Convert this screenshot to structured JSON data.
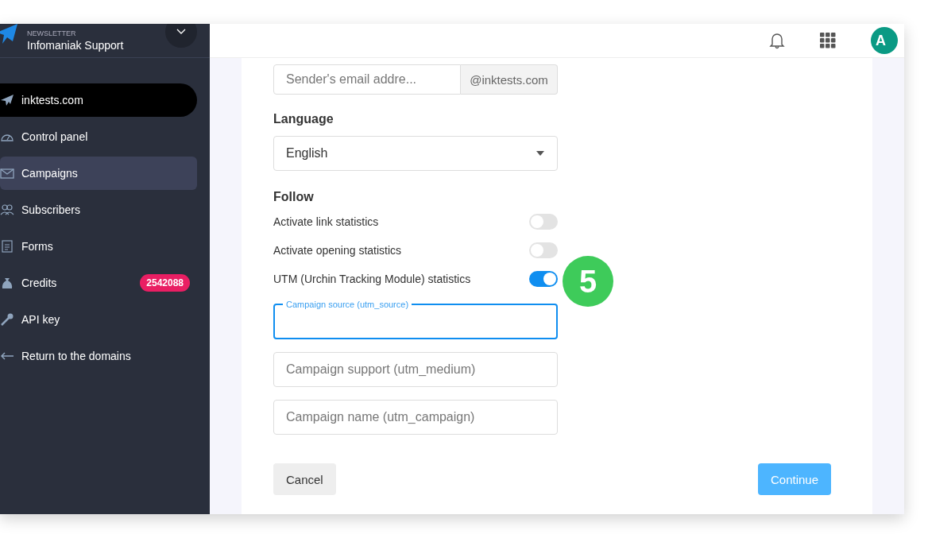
{
  "sidebar": {
    "product": "NEWSLETTER",
    "account": "Infomaniak Support",
    "items": [
      {
        "label": "inktests.com",
        "kind": "domain",
        "selected": false
      },
      {
        "label": "Control panel",
        "kind": "nav",
        "selected": false
      },
      {
        "label": "Campaigns",
        "kind": "nav",
        "selected": true
      },
      {
        "label": "Subscribers",
        "kind": "nav",
        "selected": false
      },
      {
        "label": "Forms",
        "kind": "nav",
        "selected": false
      },
      {
        "label": "Credits",
        "kind": "nav",
        "selected": false,
        "badge": "2542088"
      },
      {
        "label": "API key",
        "kind": "nav",
        "selected": false
      },
      {
        "label": "Return to the domains",
        "kind": "nav",
        "selected": false
      }
    ]
  },
  "topbar": {
    "avatar": "A"
  },
  "form": {
    "sender": {
      "placeholder": "Sender's email addre...",
      "suffix": "@inktests.com"
    },
    "language": {
      "label": "Language",
      "value": "English"
    },
    "follow": {
      "label": "Follow",
      "toggles": [
        {
          "label": "Activate link statistics",
          "on": false
        },
        {
          "label": "Activate opening statistics",
          "on": false
        },
        {
          "label": "UTM (Urchin Tracking Module) statistics",
          "on": true
        }
      ]
    },
    "utm_fields": [
      {
        "placeholder": "Campaign source (utm_source)",
        "focused": true
      },
      {
        "placeholder": "Campaign support (utm_medium)",
        "focused": false
      },
      {
        "placeholder": "Campaign name (utm_campaign)",
        "focused": false
      }
    ],
    "buttons": {
      "cancel": "Cancel",
      "continue": "Continue"
    }
  },
  "step_badge": "5"
}
